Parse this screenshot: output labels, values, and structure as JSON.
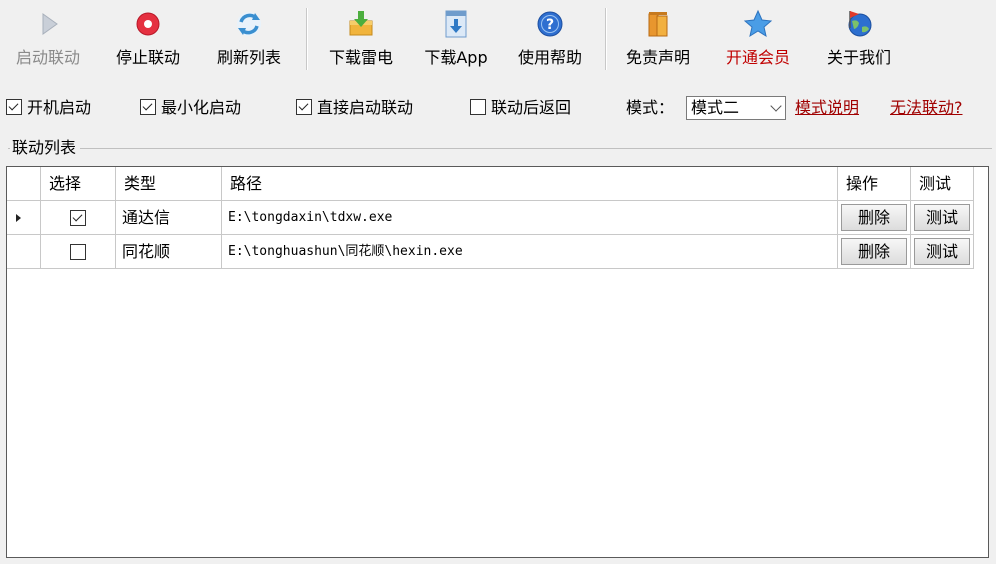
{
  "toolbar": {
    "buttons": [
      {
        "label": "启动联动",
        "icon": "play-icon"
      },
      {
        "label": "停止联动",
        "icon": "stop-icon"
      },
      {
        "label": "刷新列表",
        "icon": "refresh-icon"
      },
      {
        "label": "下载雷电",
        "icon": "download-box-icon"
      },
      {
        "label": "下载App",
        "icon": "download-app-icon"
      },
      {
        "label": "使用帮助",
        "icon": "help-icon"
      },
      {
        "label": "免责声明",
        "icon": "books-icon"
      },
      {
        "label": "开通会员",
        "icon": "star-icon"
      },
      {
        "label": "关于我们",
        "icon": "globe-icon"
      }
    ]
  },
  "options": {
    "autostart": {
      "label": "开机启动",
      "checked": true
    },
    "minimized": {
      "label": "最小化启动",
      "checked": true
    },
    "direct_link": {
      "label": "直接启动联动",
      "checked": true
    },
    "return_after": {
      "label": "联动后返回",
      "checked": false
    },
    "mode_label": "模式：",
    "mode_value": "模式二",
    "mode_help_link": "模式说明",
    "cannot_link": "无法联动?"
  },
  "group_title": "联动列表",
  "grid": {
    "headers": [
      "",
      "选择",
      "类型",
      "路径",
      "操作",
      "测试"
    ],
    "rows": [
      {
        "selected": true,
        "checked": true,
        "type": "通达信",
        "path": "E:\\tongdaxin\\tdxw.exe",
        "action": "删除",
        "test": "测试"
      },
      {
        "selected": false,
        "checked": false,
        "type": "同花顺",
        "path": "E:\\tonghuashun\\同花顺\\hexin.exe",
        "action": "删除",
        "test": "测试"
      }
    ]
  },
  "colors": {
    "accent_red": "#c00000",
    "link_red": "#a00000"
  }
}
